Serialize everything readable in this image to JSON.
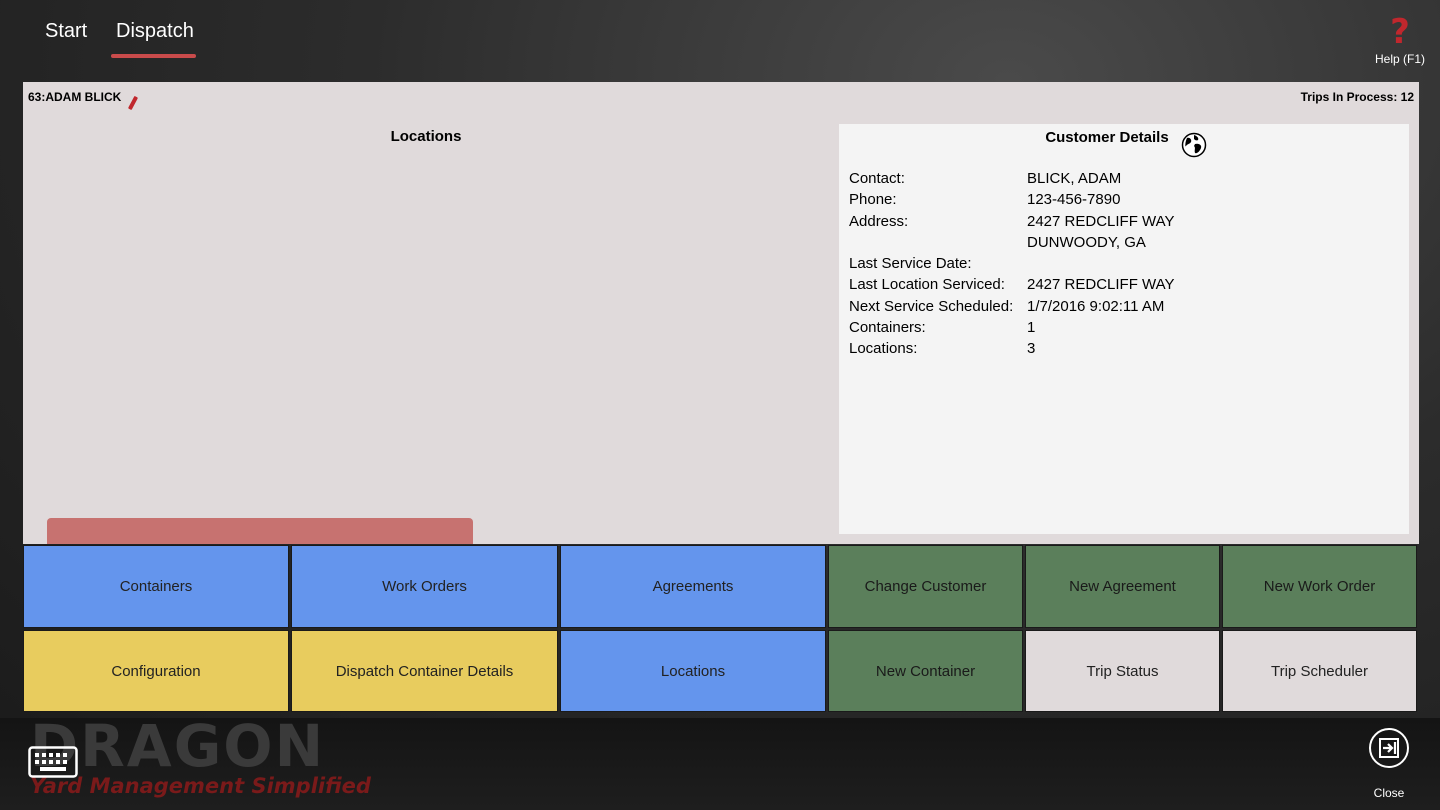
{
  "nav": {
    "tabs": [
      {
        "label": "Start"
      },
      {
        "label": "Dispatch",
        "active": true
      }
    ],
    "help_label": "Help (F1)",
    "help_glyph": "?",
    "help_color": "#c0272d"
  },
  "header": {
    "customer_id": "63:ADAM BLICK",
    "trips_in_process": "Trips In Process: 12"
  },
  "locations": {
    "title": "Locations"
  },
  "customer_details": {
    "title": "Customer Details",
    "rows": [
      {
        "label": "Contact:",
        "value": "BLICK, ADAM"
      },
      {
        "label": "Phone:",
        "value": "123-456-7890"
      },
      {
        "label": "Address:",
        "value": "2427 REDCLIFF WAY"
      },
      {
        "label": "",
        "value": "DUNWOODY, GA"
      },
      {
        "label": "Last Service Date:",
        "value": ""
      },
      {
        "label": "Last Location Serviced:",
        "value": "2427 REDCLIFF WAY"
      },
      {
        "label": "Next Service Scheduled:",
        "value": "1/7/2016 9:02:11 AM"
      },
      {
        "label": "Containers:",
        "value": "1"
      },
      {
        "label": "Locations:",
        "value": "3"
      }
    ]
  },
  "buttons": {
    "containers": "Containers",
    "work_orders": "Work Orders",
    "agreements": "Agreements",
    "change_customer": "Change Customer",
    "new_agreement": "New Agreement",
    "new_work_order": "New Work Order",
    "configuration": "Configuration",
    "dispatch_container_details": "Dispatch Container Details",
    "locations": "Locations",
    "new_container": "New Container",
    "trip_status": "Trip Status",
    "trip_scheduler": "Trip Scheduler"
  },
  "colors": {
    "blue_button": "#6495ed",
    "green_button": "#5b7f5b",
    "yellow_button": "#e8cc5e",
    "gray_button": "#e0dadb",
    "accent_red": "#c94b4b"
  },
  "bottom": {
    "brand": "DRAGON",
    "tagline": "Yard Management Simplified",
    "close_label": "Close"
  }
}
